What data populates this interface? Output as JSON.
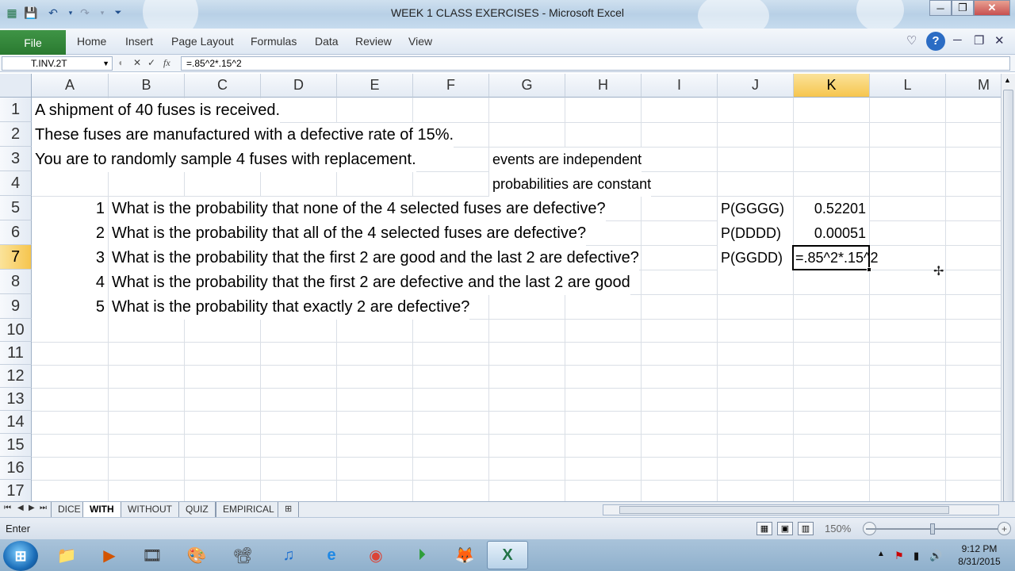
{
  "window": {
    "title": "WEEK 1 CLASS EXERCISES  -  Microsoft Excel",
    "controls": [
      "─",
      "❐",
      "✕"
    ]
  },
  "ribbon": {
    "file_tab": "File",
    "tabs": [
      "Home",
      "Insert",
      "Page Layout",
      "Formulas",
      "Data",
      "Review",
      "View"
    ]
  },
  "formula_bar": {
    "name_box": "T.INV.2T",
    "fx_symbol": "fx",
    "formula": "=.85^2*.15^2"
  },
  "grid": {
    "columns": [
      "A",
      "B",
      "C",
      "D",
      "E",
      "F",
      "G",
      "H",
      "I",
      "J",
      "K",
      "L",
      "M"
    ],
    "selected_column": "K",
    "rows": [
      "1",
      "2",
      "3",
      "4",
      "5",
      "6",
      "7",
      "8",
      "9",
      "10",
      "11",
      "12",
      "13",
      "14",
      "15",
      "16",
      "17"
    ],
    "selected_row": "7",
    "cells": {
      "A1": "A shipment of 40 fuses is received.",
      "A2": "These fuses are manufactured with a defective rate of 15%.",
      "A3": "You are to randomly sample 4 fuses with replacement.",
      "G3": "events are independent",
      "G4": "probabilities are constant",
      "A5": "1",
      "B5": "What is the probability that none of the 4 selected fuses are defective?",
      "J5": "P(GGGG)",
      "K5": "0.52201",
      "A6": "2",
      "B6": "What is the probability that all of the 4 selected fuses are defective?",
      "J6": "P(DDDD)",
      "K6": "0.00051",
      "A7": "3",
      "B7": "What is the probability that the first 2 are good and the last 2 are defective?",
      "J7": "P(GGDD)",
      "K7": "=.85^2*.15^2",
      "A8": "4",
      "B8": "What is the probability that the first 2 are defective and the last 2 are good",
      "A9": "5",
      "B9": "What is the probability that exactly 2 are defective?"
    }
  },
  "sheet_tabs": {
    "tabs": [
      "DICE",
      "WITH",
      "WITHOUT",
      "QUIZ",
      "EMPIRICAL"
    ],
    "active": "WITH"
  },
  "status_bar": {
    "mode": "Enter",
    "zoom": "150%"
  },
  "taskbar": {
    "clock_time": "9:12 PM",
    "clock_date": "8/31/2015"
  }
}
